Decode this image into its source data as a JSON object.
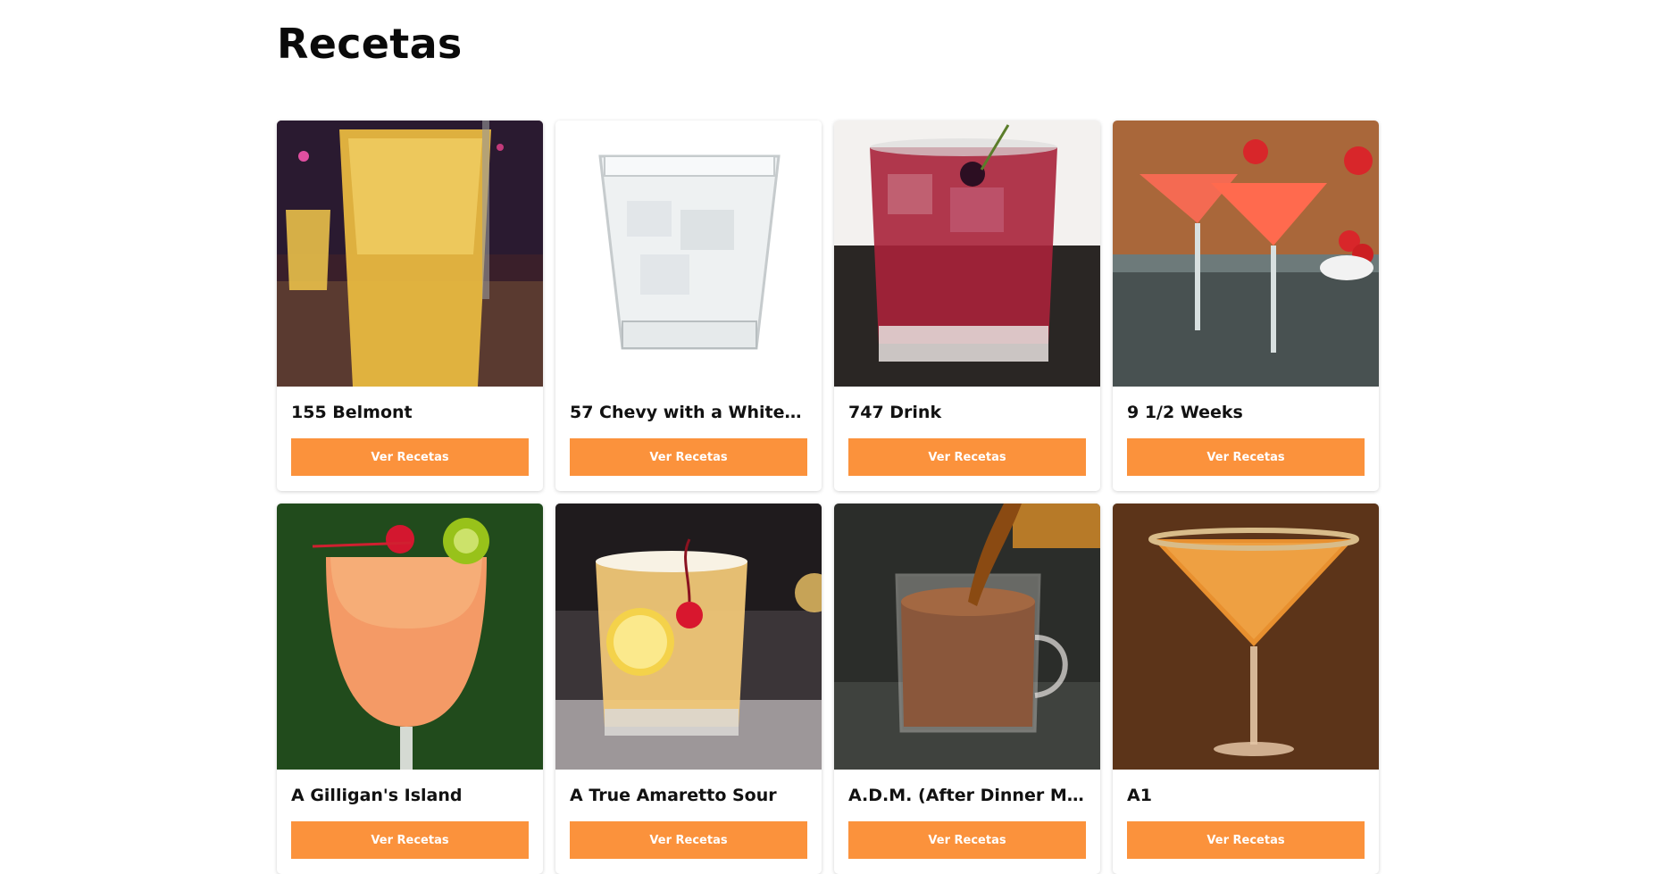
{
  "page": {
    "title": "Recetas"
  },
  "button_color": "#fb923c",
  "cards": [
    {
      "title": "155 Belmont",
      "button_label": "Ver Recetas",
      "image": "yellow-highball-drink"
    },
    {
      "title": "57 Chevy with a White Lic...",
      "button_label": "Ver Recetas",
      "image": "clear-rocks-glass-ice"
    },
    {
      "title": "747 Drink",
      "button_label": "Ver Recetas",
      "image": "red-drink-with-ice"
    },
    {
      "title": "9 1/2 Weeks",
      "button_label": "Ver Recetas",
      "image": "pink-martini-strawberries"
    },
    {
      "title": "A Gilligan's Island",
      "button_label": "Ver Recetas",
      "image": "orange-tropical-drink"
    },
    {
      "title": "A True Amaretto Sour",
      "button_label": "Ver Recetas",
      "image": "amaretto-sour-lemon-cherry"
    },
    {
      "title": "A.D.M. (After Dinner Mint)",
      "button_label": "Ver Recetas",
      "image": "hot-chocolate-mug"
    },
    {
      "title": "A1",
      "button_label": "Ver Recetas",
      "image": "orange-martini-sugar-rim"
    }
  ]
}
